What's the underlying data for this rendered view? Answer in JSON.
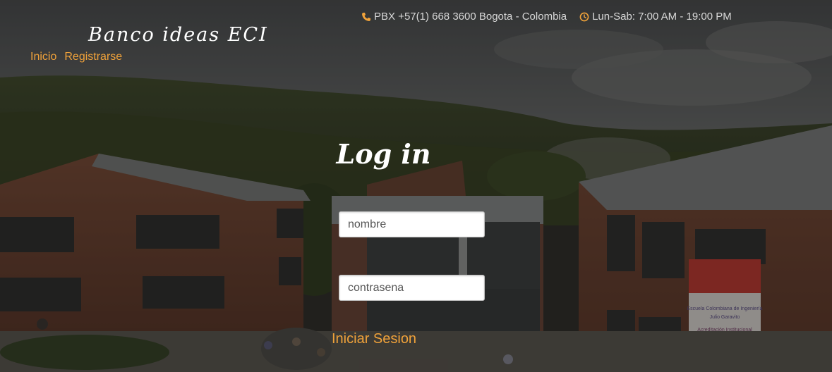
{
  "header": {
    "phone_icon": "phone-icon",
    "phone": "PBX +57(1) 668 3600 Bogota - Colombia",
    "hours_icon": "clock-icon",
    "hours": "Lun-Sab: 7:00 AM - 19:00 PM"
  },
  "brand": "Banco ideas ECI",
  "nav": {
    "home": "Inicio",
    "register": "Registrarse"
  },
  "login": {
    "title": "Log in",
    "username_placeholder": "nombre",
    "password_placeholder": "contrasena",
    "submit": "Iniciar Sesion"
  },
  "background_banner": {
    "line1": "Escuela Colombiana de Ingeniería",
    "line2": "Julio Garavito",
    "line3": "Acreditación Institucional"
  },
  "colors": {
    "accent": "#f0a23a",
    "text_light": "#d8d8d8",
    "white": "#ffffff"
  }
}
